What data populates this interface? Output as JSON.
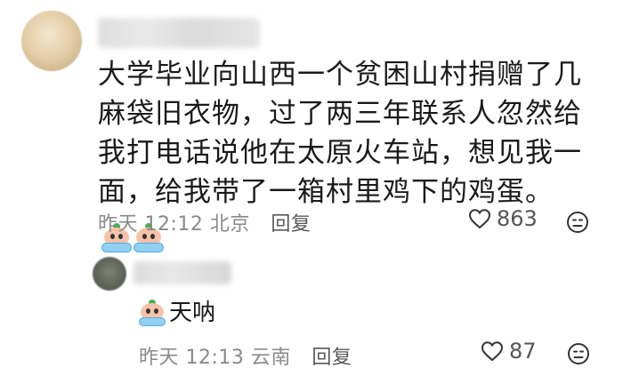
{
  "comment": {
    "text": "大学毕业向山西一个贫困山村捐赠了几麻袋旧衣物，过了两三年联系人忽然给我打电话说他在太原火车站，想见我一面，给我带了一箱村里鸡下的鸡蛋。",
    "emoji": "crying-face",
    "time": "昨天 12:12",
    "location": "北京",
    "reply_label": "回复",
    "like_count": "863"
  },
  "reply": {
    "text": "天呐",
    "emoji": "crying-face",
    "time": "昨天 12:13",
    "location": "云南",
    "reply_label": "回复",
    "like_count": "87"
  },
  "colors": {
    "text_primary": "#1a1a1a",
    "text_meta": "#8a8a8a"
  },
  "icons": [
    "heart-icon",
    "dislike-icon",
    "crying-emoji-icon"
  ]
}
